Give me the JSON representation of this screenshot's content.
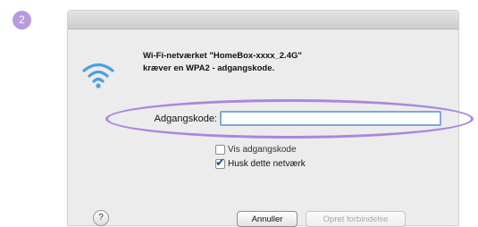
{
  "step_badge": "2",
  "dialog": {
    "icon": "wifi-icon",
    "message_line1": "Wi-Fi-netværket \"HomeBox-xxxx_2.4G\"",
    "message_line2": "kræver en WPA2 - adgangskode.",
    "password_label": "Adgangskode:",
    "password_value": "",
    "show_password_label": "Vis adgangskode",
    "show_password_checked": false,
    "remember_network_label": "Husk dette netværk",
    "remember_network_checked": true,
    "help_label": "?",
    "cancel_label": "Annuller",
    "connect_label": "Opret forbindelse",
    "connect_enabled": false
  },
  "colors": {
    "badge": "#b89ade",
    "highlight_ellipse": "#a987df",
    "wifi_icon": "#4a9fe0",
    "focus_ring": "#7fa8d8"
  }
}
